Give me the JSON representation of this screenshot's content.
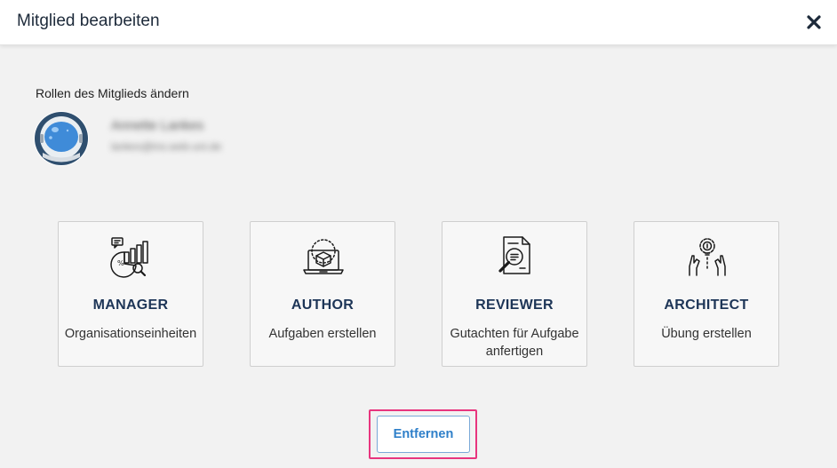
{
  "dialog": {
    "title": "Mitglied bearbeiten",
    "close_icon": "close-icon"
  },
  "member": {
    "section_label": "Rollen des Mitglieds ändern",
    "name": "Annette Lankes",
    "email": "lankes@ins.web-uni.de",
    "avatar_icon": "astronaut-helmet-avatar"
  },
  "roles": [
    {
      "title": "MANAGER",
      "description": "Organisationseinheiten",
      "icon": "manager-analytics-icon"
    },
    {
      "title": "AUTHOR",
      "description": "Aufgaben erstellen",
      "icon": "author-laptop-cube-icon"
    },
    {
      "title": "REVIEWER",
      "description": "Gutachten für Aufgabe anfertigen",
      "icon": "reviewer-document-magnifier-icon"
    },
    {
      "title": "ARCHITECT",
      "description": "Übung erstellen",
      "icon": "architect-hands-gear-bulb-icon"
    }
  ],
  "actions": {
    "remove_label": "Entfernen"
  },
  "colors": {
    "background": "#f2f2f2",
    "header_background": "#ffffff",
    "role_title": "#1d3557",
    "button_text": "#2e7fc9",
    "highlight": "#e8357e"
  }
}
